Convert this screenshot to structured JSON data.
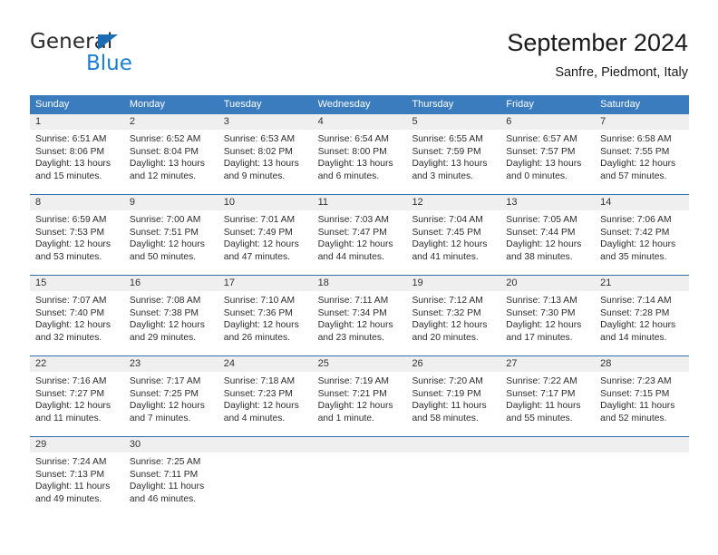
{
  "brand": {
    "name_part1": "General",
    "name_part2": "Blue",
    "logo_icon": "triangle-logo-icon"
  },
  "header": {
    "title": "September 2024",
    "subtitle": "Sanfre, Piedmont, Italy"
  },
  "calendar": {
    "weekdays": [
      "Sunday",
      "Monday",
      "Tuesday",
      "Wednesday",
      "Thursday",
      "Friday",
      "Saturday"
    ],
    "colors": {
      "header_bg": "#3a7cbe",
      "header_text": "#ffffff",
      "daynum_bg": "#efefef",
      "row_divider": "#2e6ead",
      "brand_blue": "#1a7fd4",
      "logo_blue": "#1a6cb5"
    },
    "weeks": [
      {
        "days": [
          {
            "num": "1",
            "lines": [
              "Sunrise: 6:51 AM",
              "Sunset: 8:06 PM",
              "Daylight: 13 hours",
              "and 15 minutes."
            ]
          },
          {
            "num": "2",
            "lines": [
              "Sunrise: 6:52 AM",
              "Sunset: 8:04 PM",
              "Daylight: 13 hours",
              "and 12 minutes."
            ]
          },
          {
            "num": "3",
            "lines": [
              "Sunrise: 6:53 AM",
              "Sunset: 8:02 PM",
              "Daylight: 13 hours",
              "and 9 minutes."
            ]
          },
          {
            "num": "4",
            "lines": [
              "Sunrise: 6:54 AM",
              "Sunset: 8:00 PM",
              "Daylight: 13 hours",
              "and 6 minutes."
            ]
          },
          {
            "num": "5",
            "lines": [
              "Sunrise: 6:55 AM",
              "Sunset: 7:59 PM",
              "Daylight: 13 hours",
              "and 3 minutes."
            ]
          },
          {
            "num": "6",
            "lines": [
              "Sunrise: 6:57 AM",
              "Sunset: 7:57 PM",
              "Daylight: 13 hours",
              "and 0 minutes."
            ]
          },
          {
            "num": "7",
            "lines": [
              "Sunrise: 6:58 AM",
              "Sunset: 7:55 PM",
              "Daylight: 12 hours",
              "and 57 minutes."
            ]
          }
        ]
      },
      {
        "days": [
          {
            "num": "8",
            "lines": [
              "Sunrise: 6:59 AM",
              "Sunset: 7:53 PM",
              "Daylight: 12 hours",
              "and 53 minutes."
            ]
          },
          {
            "num": "9",
            "lines": [
              "Sunrise: 7:00 AM",
              "Sunset: 7:51 PM",
              "Daylight: 12 hours",
              "and 50 minutes."
            ]
          },
          {
            "num": "10",
            "lines": [
              "Sunrise: 7:01 AM",
              "Sunset: 7:49 PM",
              "Daylight: 12 hours",
              "and 47 minutes."
            ]
          },
          {
            "num": "11",
            "lines": [
              "Sunrise: 7:03 AM",
              "Sunset: 7:47 PM",
              "Daylight: 12 hours",
              "and 44 minutes."
            ]
          },
          {
            "num": "12",
            "lines": [
              "Sunrise: 7:04 AM",
              "Sunset: 7:45 PM",
              "Daylight: 12 hours",
              "and 41 minutes."
            ]
          },
          {
            "num": "13",
            "lines": [
              "Sunrise: 7:05 AM",
              "Sunset: 7:44 PM",
              "Daylight: 12 hours",
              "and 38 minutes."
            ]
          },
          {
            "num": "14",
            "lines": [
              "Sunrise: 7:06 AM",
              "Sunset: 7:42 PM",
              "Daylight: 12 hours",
              "and 35 minutes."
            ]
          }
        ]
      },
      {
        "days": [
          {
            "num": "15",
            "lines": [
              "Sunrise: 7:07 AM",
              "Sunset: 7:40 PM",
              "Daylight: 12 hours",
              "and 32 minutes."
            ]
          },
          {
            "num": "16",
            "lines": [
              "Sunrise: 7:08 AM",
              "Sunset: 7:38 PM",
              "Daylight: 12 hours",
              "and 29 minutes."
            ]
          },
          {
            "num": "17",
            "lines": [
              "Sunrise: 7:10 AM",
              "Sunset: 7:36 PM",
              "Daylight: 12 hours",
              "and 26 minutes."
            ]
          },
          {
            "num": "18",
            "lines": [
              "Sunrise: 7:11 AM",
              "Sunset: 7:34 PM",
              "Daylight: 12 hours",
              "and 23 minutes."
            ]
          },
          {
            "num": "19",
            "lines": [
              "Sunrise: 7:12 AM",
              "Sunset: 7:32 PM",
              "Daylight: 12 hours",
              "and 20 minutes."
            ]
          },
          {
            "num": "20",
            "lines": [
              "Sunrise: 7:13 AM",
              "Sunset: 7:30 PM",
              "Daylight: 12 hours",
              "and 17 minutes."
            ]
          },
          {
            "num": "21",
            "lines": [
              "Sunrise: 7:14 AM",
              "Sunset: 7:28 PM",
              "Daylight: 12 hours",
              "and 14 minutes."
            ]
          }
        ]
      },
      {
        "days": [
          {
            "num": "22",
            "lines": [
              "Sunrise: 7:16 AM",
              "Sunset: 7:27 PM",
              "Daylight: 12 hours",
              "and 11 minutes."
            ]
          },
          {
            "num": "23",
            "lines": [
              "Sunrise: 7:17 AM",
              "Sunset: 7:25 PM",
              "Daylight: 12 hours",
              "and 7 minutes."
            ]
          },
          {
            "num": "24",
            "lines": [
              "Sunrise: 7:18 AM",
              "Sunset: 7:23 PM",
              "Daylight: 12 hours",
              "and 4 minutes."
            ]
          },
          {
            "num": "25",
            "lines": [
              "Sunrise: 7:19 AM",
              "Sunset: 7:21 PM",
              "Daylight: 12 hours",
              "and 1 minute."
            ]
          },
          {
            "num": "26",
            "lines": [
              "Sunrise: 7:20 AM",
              "Sunset: 7:19 PM",
              "Daylight: 11 hours",
              "and 58 minutes."
            ]
          },
          {
            "num": "27",
            "lines": [
              "Sunrise: 7:22 AM",
              "Sunset: 7:17 PM",
              "Daylight: 11 hours",
              "and 55 minutes."
            ]
          },
          {
            "num": "28",
            "lines": [
              "Sunrise: 7:23 AM",
              "Sunset: 7:15 PM",
              "Daylight: 11 hours",
              "and 52 minutes."
            ]
          }
        ]
      },
      {
        "days": [
          {
            "num": "29",
            "lines": [
              "Sunrise: 7:24 AM",
              "Sunset: 7:13 PM",
              "Daylight: 11 hours",
              "and 49 minutes."
            ]
          },
          {
            "num": "30",
            "lines": [
              "Sunrise: 7:25 AM",
              "Sunset: 7:11 PM",
              "Daylight: 11 hours",
              "and 46 minutes."
            ]
          },
          {
            "num": "",
            "lines": []
          },
          {
            "num": "",
            "lines": []
          },
          {
            "num": "",
            "lines": []
          },
          {
            "num": "",
            "lines": []
          },
          {
            "num": "",
            "lines": []
          }
        ]
      }
    ]
  }
}
